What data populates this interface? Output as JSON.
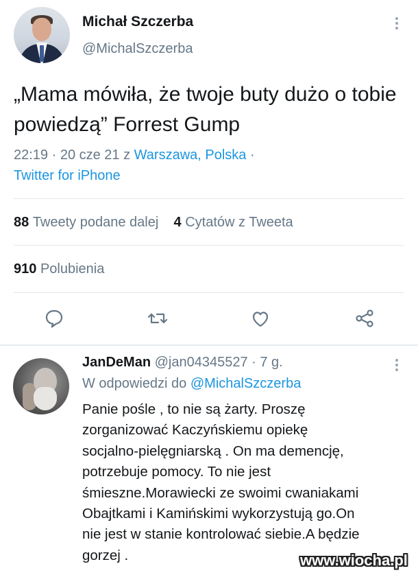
{
  "tweet": {
    "author_name": "Michał Szczerba",
    "author_handle": "@MichalSzczerba",
    "text": "„Mama mówiła, że twoje buty dużo o tobie powiedzą” Forrest Gump",
    "time": "22:19 · 20 cze 21 z ",
    "location": "Warszawa, Polska",
    "location_sep": " ·",
    "source": "Twitter for iPhone",
    "retweets_count": "88",
    "retweets_label": "Tweety podane dalej",
    "quotes_count": "4",
    "quotes_label": "Cytatów z Tweeta",
    "likes_count": "910",
    "likes_label": "Polubienia",
    "actions": [
      "reply-icon",
      "retweet-icon",
      "like-icon",
      "share-icon"
    ]
  },
  "reply": {
    "author_name": "JanDeMan",
    "author_handle": "@jan04345527",
    "age": "· 7 g.",
    "reply_to_prefix": "W odpowiedzi do ",
    "reply_to_handle": "@MichalSzczerba",
    "lines": [
      "Panie pośle , to nie są żarty. Proszę",
      "zorganizować Kaczyńskiemu opiekę",
      "socjalno-pielęgniarską . On ma demencję,",
      "potrzebuje pomocy. To nie jest",
      "śmieszne.Morawiecki ze swoimi cwaniakami",
      "Obajtkami i Kamińskimi wykorzystują go.On",
      "nie jest w stanie kontrolować siebie.A będzie",
      "gorzej ."
    ]
  },
  "watermark": "www.wiocha.pl",
  "colors": {
    "link": "#1b95e0",
    "secondary_text": "#657786",
    "primary_text": "#14171a",
    "divider": "#e1e8ed"
  }
}
